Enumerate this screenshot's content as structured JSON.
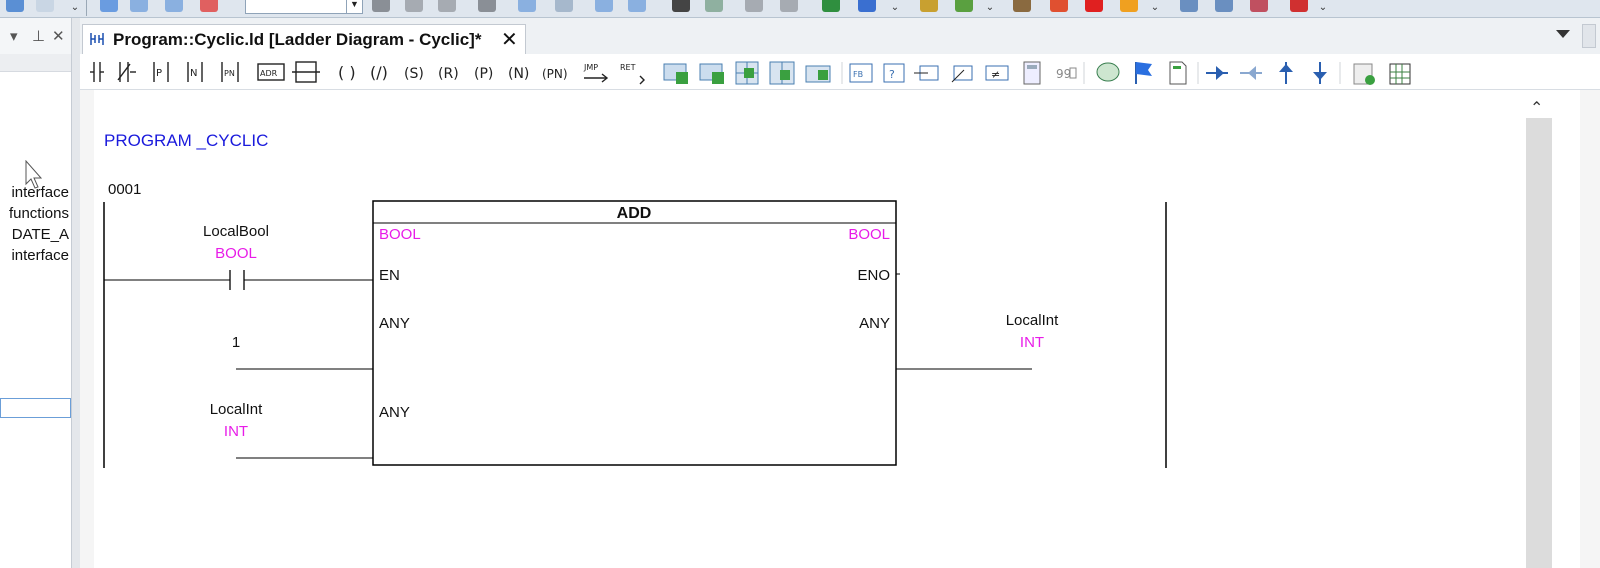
{
  "window": {
    "tab_title": "Program::Cyclic.ld [Ladder Diagram - Cyclic]*"
  },
  "left_panel": {
    "lines": [
      "interface",
      "functions",
      "DATE_A",
      "interface"
    ]
  },
  "editor": {
    "program_header": "PROGRAM _CYCLIC",
    "network_number": "0001"
  },
  "ladder": {
    "contact": {
      "name": "LocalBool",
      "type": "BOOL"
    },
    "block": {
      "name": "ADD",
      "en_type": "BOOL",
      "eno_type": "BOOL",
      "en_label": "EN",
      "eno_label": "ENO",
      "in1_label": "ANY",
      "in2_label": "ANY",
      "out_label": "ANY"
    },
    "input1": {
      "value": "1"
    },
    "input2": {
      "name": "LocalInt",
      "type": "INT"
    },
    "output": {
      "name": "LocalInt",
      "type": "INT"
    }
  },
  "colors": {
    "header_blue": "#1a1adc",
    "type_magenta": "#e81ce8",
    "wire": "#000000"
  },
  "icons": {
    "tab_icon": "ladder-diagram-icon",
    "close": "close-icon",
    "panel_menu": "dropdown-icon",
    "panel_pin": "pin-icon",
    "panel_close": "close-icon"
  }
}
